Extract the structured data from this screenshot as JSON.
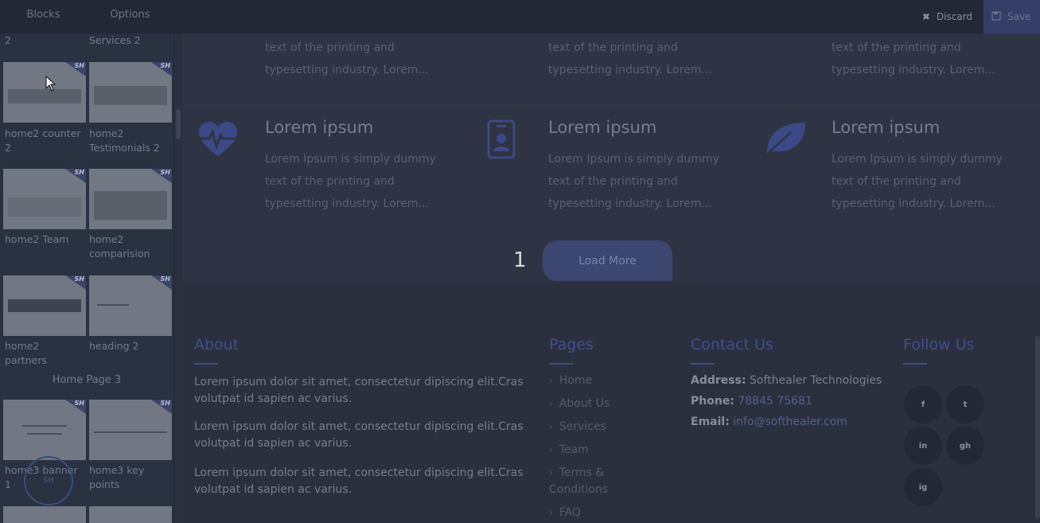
{
  "topbar": {
    "tabs": [
      "Blocks",
      "Options"
    ],
    "discard_label": "Discard",
    "save_label": "Save"
  },
  "sidebar": {
    "top_labels": [
      "2",
      "Services 2"
    ],
    "blocks": [
      {
        "label": "home2 counter 2"
      },
      {
        "label": "home2 Testimonials 2"
      },
      {
        "label": "home2 Team"
      },
      {
        "label": "home2 comparision"
      },
      {
        "label": "home2 partners"
      },
      {
        "label": "heading 2"
      },
      {
        "label": "home3 banner 1"
      },
      {
        "label": "home3 key points"
      }
    ],
    "section_title": "Home Page 3",
    "badge": "SH"
  },
  "main": {
    "top_features": [
      {
        "text": "text of the printing and typesetting industry. Lorem..."
      },
      {
        "text": "text of the printing and typesetting industry. Lorem..."
      },
      {
        "text": "text of the printing and typesetting industry. Lorem..."
      }
    ],
    "features": [
      {
        "icon": "heart-pulse-icon",
        "title": "Lorem ipsum",
        "text": "Lorem Ipsum is simply dummy text of the printing and typesetting industry. Lorem..."
      },
      {
        "icon": "id-badge-icon",
        "title": "Lorem ipsum",
        "text": "Lorem Ipsum is simply dummy text of the printing and typesetting industry. Lorem..."
      },
      {
        "icon": "leaf-icon",
        "title": "Lorem ipsum",
        "text": "Lorem Ipsum is simply dummy text of the printing and typesetting industry. Lorem..."
      }
    ],
    "pager_number": "1",
    "load_more_label": "Load More"
  },
  "footer": {
    "about": {
      "heading": "About",
      "paragraphs": [
        "Lorem ipsum dolor sit amet, consectetur dipiscing elit.Cras volutpat id sapien ac varius.",
        "Lorem ipsum dolor sit amet, consectetur dipiscing elit.Cras volutpat id sapien ac varius.",
        "Lorem ipsum dolor sit amet, consectetur dipiscing elit.Cras volutpat id sapien ac varius."
      ]
    },
    "pages": {
      "heading": "Pages",
      "links": [
        "Home",
        "About Us",
        "Services",
        "Team",
        "Terms &",
        "Conditions",
        "FAQ"
      ]
    },
    "contact": {
      "heading": "Contact Us",
      "address_label": "Address:",
      "address_value": "Softhealer Technologies",
      "phone_label": "Phone:",
      "phone_value": "78845 75681",
      "email_label": "Email:",
      "email_value": "info@softhealer.com"
    },
    "follow": {
      "heading": "Follow Us",
      "icons": [
        "facebook-icon",
        "twitter-icon",
        "linkedin-icon",
        "github-icon",
        "instagram-icon"
      ],
      "glyphs": [
        "f",
        "t",
        "in",
        "gh",
        "ig"
      ]
    }
  }
}
